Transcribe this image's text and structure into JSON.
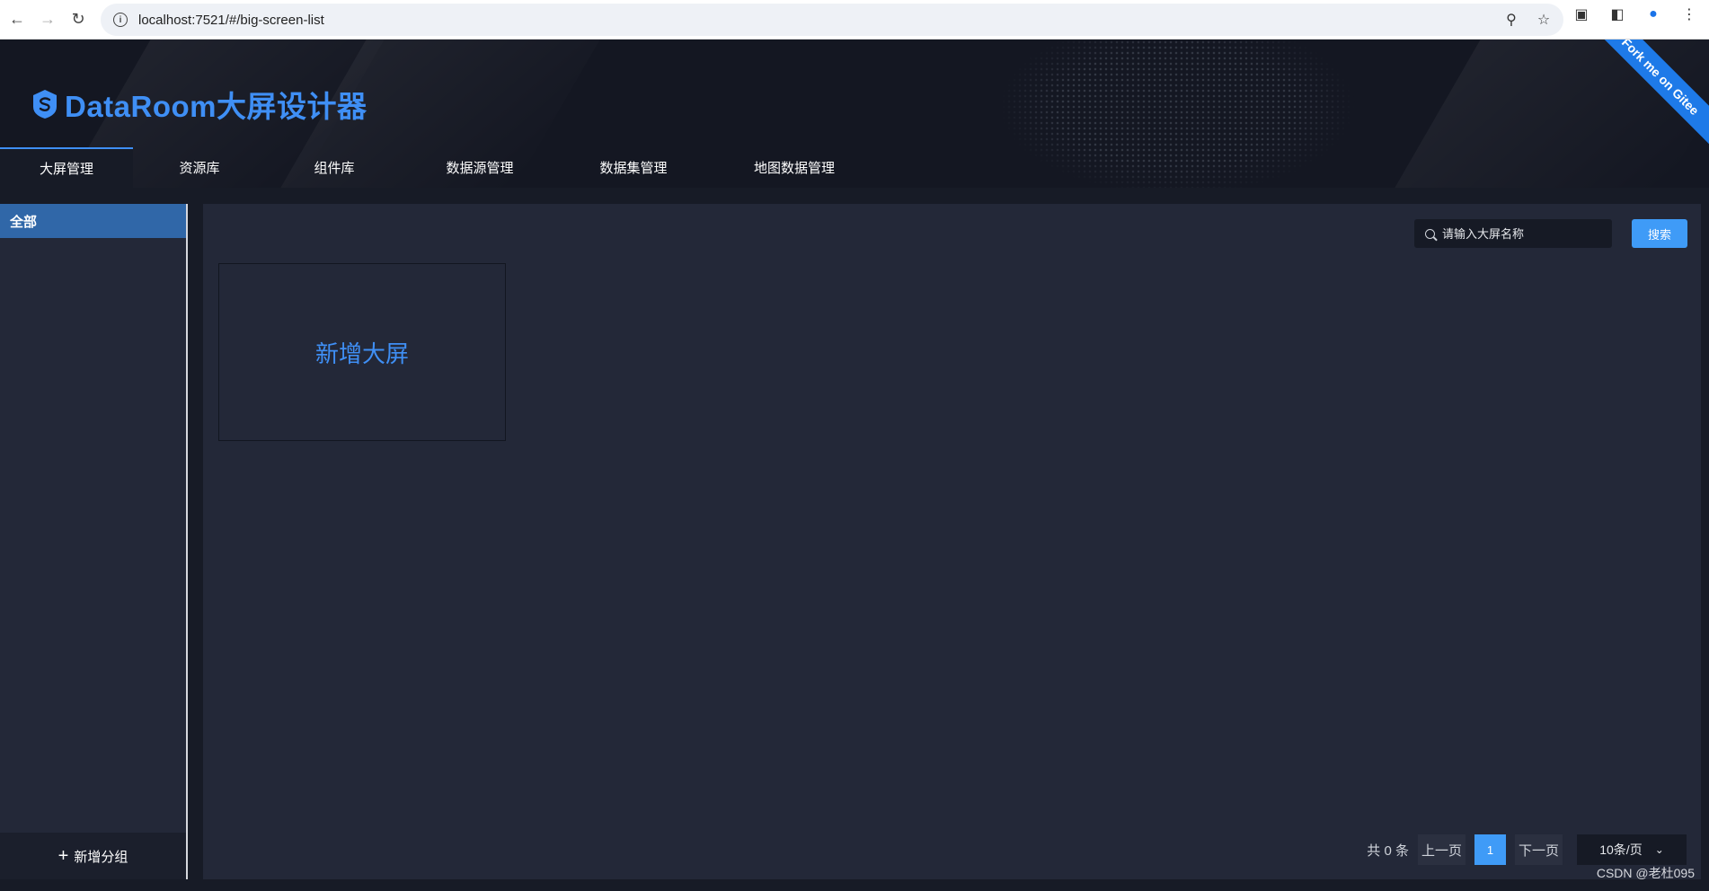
{
  "browser": {
    "url": "localhost:7521/#/big-screen-list"
  },
  "header": {
    "title": "DataRoom大屏设计器",
    "ribbon": "Fork me on Gitee",
    "tabs": [
      {
        "label": "大屏管理",
        "active": true
      },
      {
        "label": "资源库",
        "active": false
      },
      {
        "label": "组件库",
        "active": false
      },
      {
        "label": "数据源管理",
        "active": false
      },
      {
        "label": "数据集管理",
        "active": false
      },
      {
        "label": "地图数据管理",
        "active": false
      }
    ]
  },
  "sidebar": {
    "items": [
      {
        "label": "全部",
        "active": true
      }
    ],
    "add_group_label": "新增分组"
  },
  "main": {
    "search": {
      "placeholder": "请输入大屏名称",
      "value": ""
    },
    "search_button": "搜索",
    "add_card_label": "新增大屏",
    "pagination": {
      "total_label": "共 0 条",
      "prev_label": "上一页",
      "current_page": "1",
      "next_label": "下一页",
      "page_size_label": "10条/页"
    }
  },
  "watermark": "CSDN @老杜095",
  "colors": {
    "accent": "#3f8ff5",
    "button": "#3f9bf7",
    "sidebar_active": "#3067a8",
    "panel_bg": "#232838",
    "header_bg": "#141722"
  }
}
